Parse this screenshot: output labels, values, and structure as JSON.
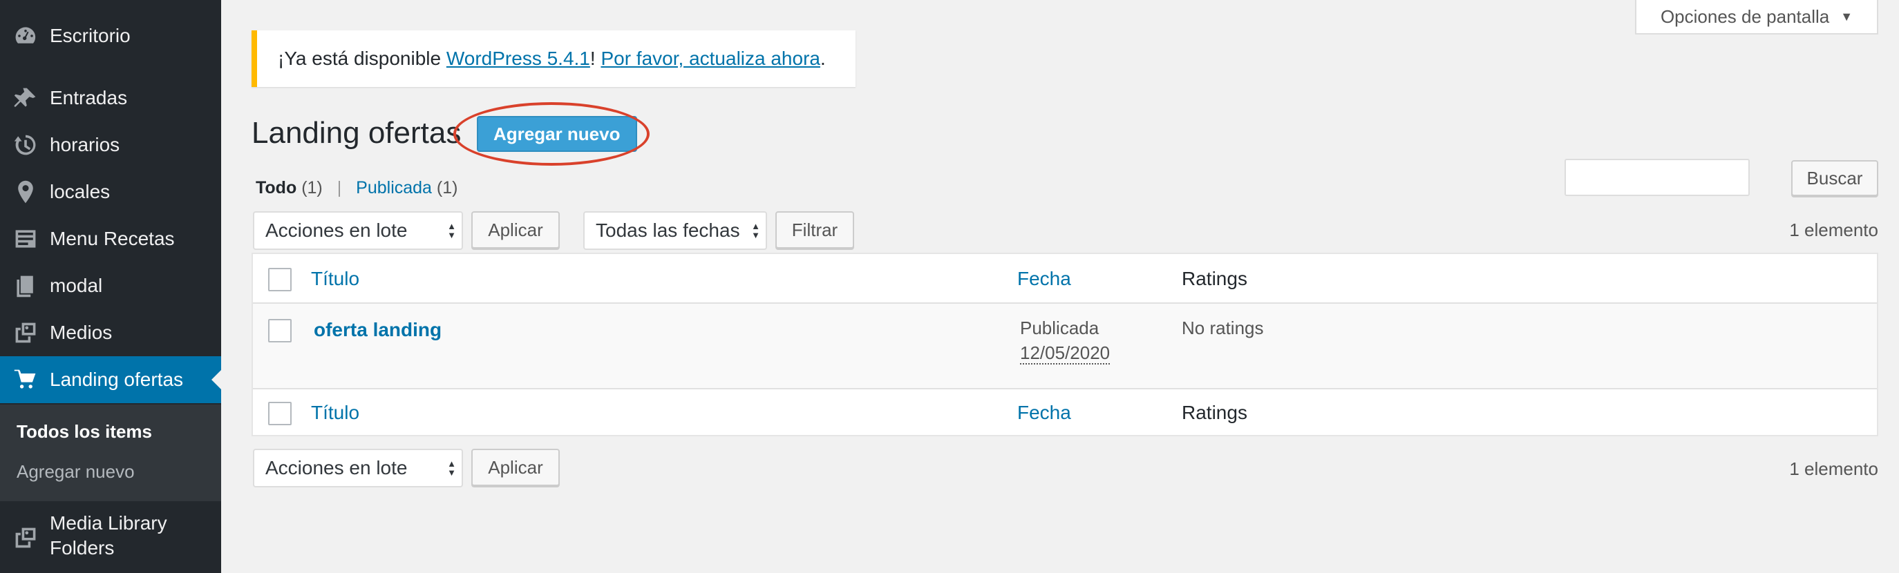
{
  "sidebar": {
    "items": [
      {
        "label": "Escritorio",
        "icon": "dashboard-icon"
      },
      {
        "label": "Entradas",
        "icon": "pin-icon"
      },
      {
        "label": "horarios",
        "icon": "history-icon"
      },
      {
        "label": "locales",
        "icon": "location-icon"
      },
      {
        "label": "Menu Recetas",
        "icon": "document-icon"
      },
      {
        "label": "modal",
        "icon": "pages-icon"
      },
      {
        "label": "Medios",
        "icon": "media-icon"
      },
      {
        "label": "Landing ofertas",
        "icon": "cart-icon"
      }
    ],
    "submenu": [
      "Todos los items",
      "Agregar nuevo"
    ],
    "extra_item": {
      "label_line1": "Media Library",
      "label_line2": "Folders",
      "icon": "media-icon"
    }
  },
  "screen_options": {
    "label": "Opciones de pantalla"
  },
  "notice": {
    "prefix": "¡Ya está disponible ",
    "version_link": "WordPress 5.4.1",
    "middle": "! ",
    "update_link": "Por favor, actualiza ahora",
    "suffix": "."
  },
  "page": {
    "title": "Landing ofertas",
    "add_new": "Agregar nuevo"
  },
  "views": {
    "all_label": "Todo",
    "all_count": "(1)",
    "separator": "|",
    "published_label": "Publicada",
    "published_count": "(1)"
  },
  "search": {
    "button": "Buscar",
    "value": ""
  },
  "tablenav_top": {
    "bulk_actions": "Acciones en lote",
    "apply": "Aplicar",
    "dates": "Todas las fechas",
    "filter": "Filtrar",
    "count": "1 elemento"
  },
  "table": {
    "columns": {
      "title": "Título",
      "date": "Fecha",
      "ratings": "Ratings"
    },
    "rows": [
      {
        "title": "oferta landing",
        "status": "Publicada",
        "date": "12/05/2020",
        "ratings": "No ratings"
      }
    ]
  },
  "tablenav_bottom": {
    "bulk_actions": "Acciones en lote",
    "apply": "Aplicar",
    "count": "1 elemento"
  },
  "colors": {
    "sidebar_bg": "#23282d",
    "active_bg": "#0073aa",
    "link": "#0073aa",
    "notice_border": "#ffb900",
    "highlight": "#d9412b"
  }
}
